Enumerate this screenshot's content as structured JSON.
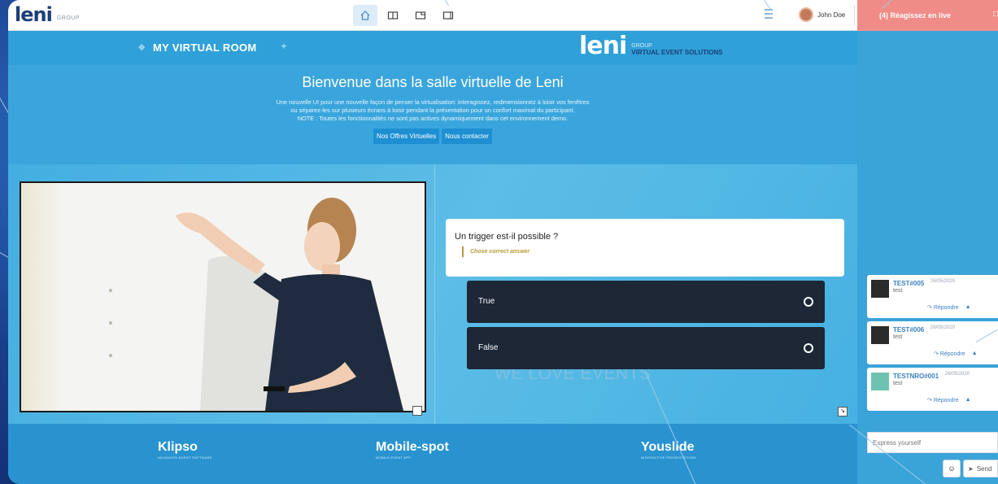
{
  "topbar": {
    "logo": "leni",
    "logo_tag": "GROUP",
    "nav": [
      "home-icon",
      "split-view-icon",
      "presentation-icon",
      "single-view-icon"
    ],
    "user_name": "John Doe",
    "live_label": "(4) Réagissez en live"
  },
  "header": {
    "room_title": "MY VIRTUAL ROOM",
    "brand": "leni",
    "brand_group": "GROUP",
    "brand_tagline": "VIRTUAL EVENT SOLUTIONS"
  },
  "welcome": {
    "title": "Bienvenue dans la salle virtuelle de Leni",
    "line1": "Une nouvelle UI pour une nouvelle façon de penser la virtualisation: interagissez, redimensionnez à loisir vos fenêtres",
    "line2": "ou séparez-les sur plusieurs écrans à loisir pendant la présentation pour un confort maximal du participant.",
    "line3": "NOTE : Toutes les fonctionnalités ne sont pas actives dynamiquement dans cet environnement demo.",
    "cta_offers": "Nos Offres Virtuelles",
    "cta_contact": "Nous contacter"
  },
  "stage": {
    "watermark": "WE LOVE EVENTS",
    "quiz": {
      "question": "Un trigger est-il possible ?",
      "hint": "Chose correct answer",
      "answers": [
        "True",
        "False"
      ]
    }
  },
  "sponsors": {
    "items": [
      {
        "name": "Klipso",
        "sub": "ADVANCED EVENT SOFTWARE"
      },
      {
        "name": "Mobile-spot",
        "sub": "MOBILE EVENT APP"
      },
      {
        "name": "Youslide",
        "sub": "INTERACTIVE PRESENTATIONS"
      }
    ]
  },
  "chat": {
    "comments": [
      {
        "user": "TEST#005",
        "date": "26/05/2020",
        "text": "test",
        "reply": "Répondre"
      },
      {
        "user": "TEST#006",
        "date": "26/05/2020",
        "text": "test",
        "reply": "Répondre"
      },
      {
        "user": "TESTNRO#001",
        "date": "26/05/2020",
        "text": "test",
        "reply": "Répondre"
      }
    ],
    "input_placeholder": "Express yourself",
    "send_label": "Send"
  },
  "colors": {
    "live_bar": "#f08c88",
    "answer_bg": "#1d2736",
    "brand_navy": "#1b3e78",
    "accent_blue": "#3aa5dc"
  }
}
